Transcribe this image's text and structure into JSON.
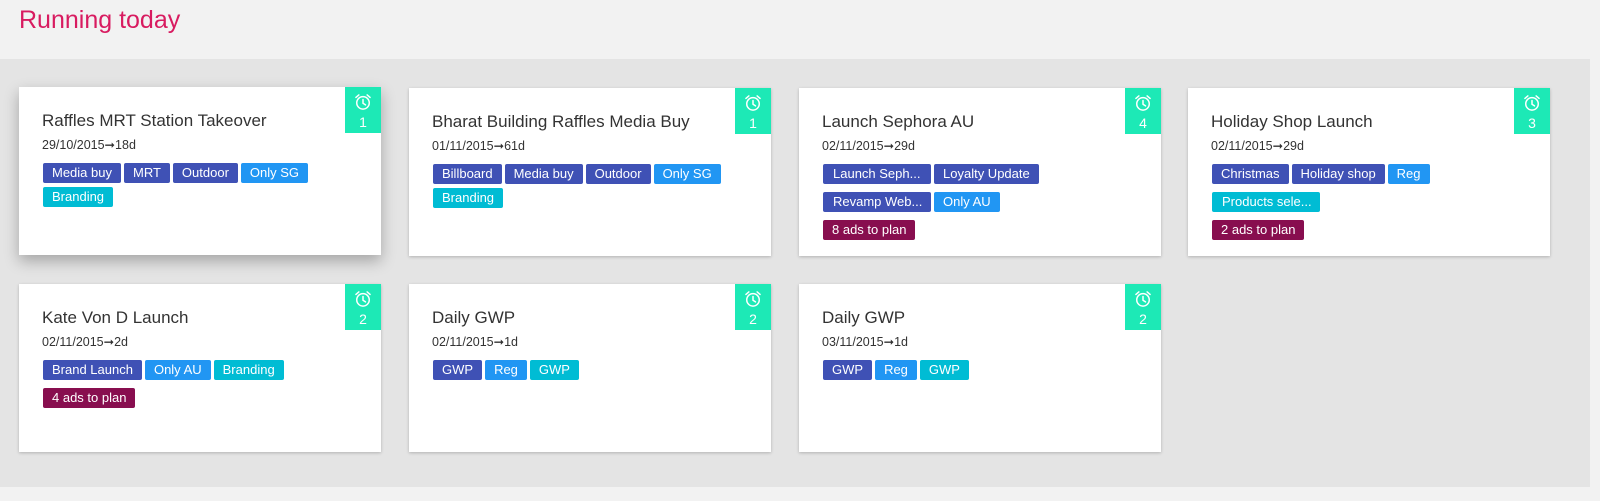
{
  "page": {
    "title": "Running today"
  },
  "colors": {
    "title": "#d81b60",
    "alarm": "#1de9b6",
    "tag_indigo": "#3f51b5",
    "tag_blue": "#2196f3",
    "tag_cyan": "#00bcd4",
    "tag_maroon": "#880e4f"
  },
  "icons": {
    "alarm": "alarm-clock-icon"
  },
  "cards": [
    {
      "title": "Raffles MRT Station Takeover",
      "date": "29/10/2015➞18d",
      "alarm_count": "1",
      "tags": [
        "Media buy",
        "MRT",
        "Outdoor",
        "Only SG",
        "Branding"
      ]
    },
    {
      "title": "Bharat Building Raffles Media Buy",
      "date": "01/11/2015➞61d",
      "alarm_count": "1",
      "tags": [
        "Billboard",
        "Media buy",
        "Outdoor",
        "Only SG",
        "Branding"
      ]
    },
    {
      "title": "Launch Sephora AU",
      "date": "02/11/2015➞29d",
      "alarm_count": "4",
      "tags": [
        "Launch Seph...",
        "Loyalty Update",
        "Revamp Web...",
        "Only AU",
        "8 ads to plan"
      ]
    },
    {
      "title": "Holiday Shop Launch",
      "date": "02/11/2015➞29d",
      "alarm_count": "3",
      "tags": [
        "Christmas",
        "Holiday shop",
        "Reg",
        "Products sele...",
        "2 ads to plan"
      ]
    },
    {
      "title": "Kate Von D Launch",
      "date": "02/11/2015➞2d",
      "alarm_count": "2",
      "tags": [
        "Brand Launch",
        "Only AU",
        "Branding",
        "4 ads to plan"
      ]
    },
    {
      "title": "Daily GWP",
      "date": "02/11/2015➞1d",
      "alarm_count": "2",
      "tags": [
        "GWP",
        "Reg",
        "GWP"
      ]
    },
    {
      "title": "Daily GWP",
      "date": "03/11/2015➞1d",
      "alarm_count": "2",
      "tags": [
        "GWP",
        "Reg",
        "GWP"
      ]
    }
  ]
}
